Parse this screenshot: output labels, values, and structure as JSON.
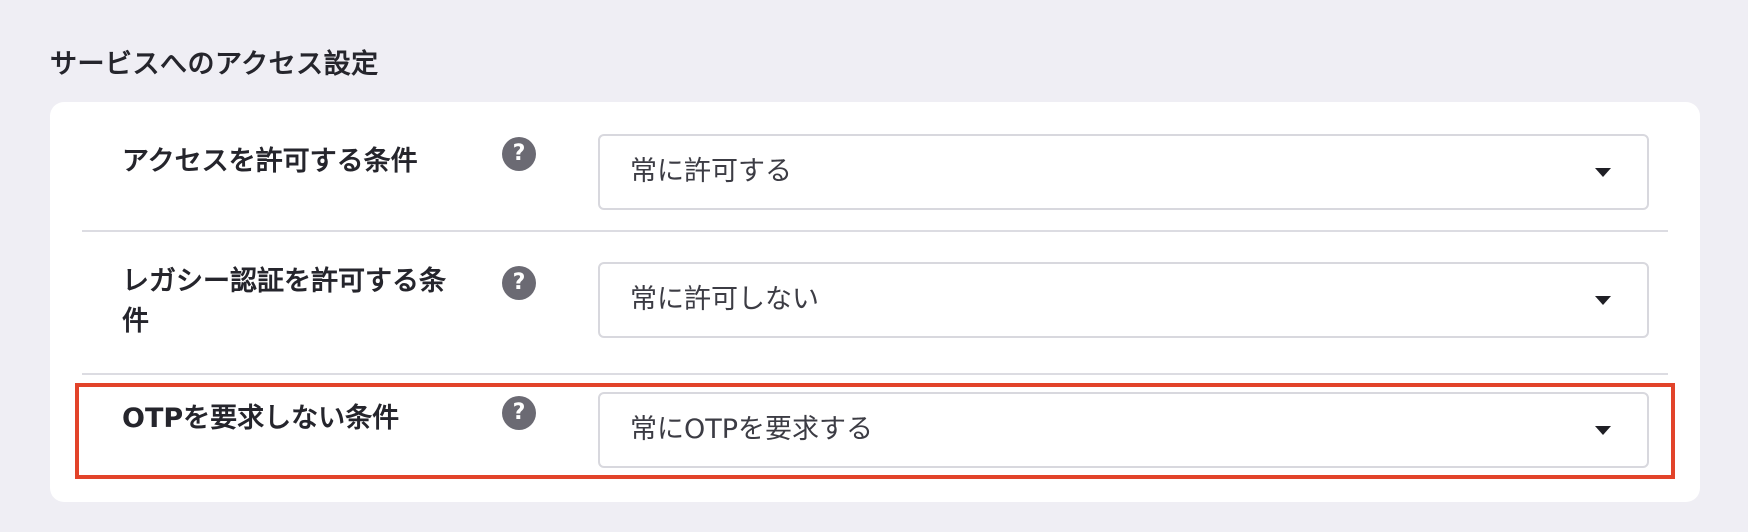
{
  "section": {
    "title": "サービスへのアクセス設定"
  },
  "settings": [
    {
      "label": "アクセスを許可する条件",
      "help_icon": "question-circle-icon",
      "selected_value": "常に許可する"
    },
    {
      "label": "レガシー認証を許可する条件",
      "help_icon": "question-circle-icon",
      "selected_value": "常に許可しない"
    },
    {
      "label": "OTPを要求しない条件",
      "help_icon": "question-circle-icon",
      "selected_value": "常にOTPを要求する",
      "highlighted": true
    }
  ],
  "colors": {
    "background": "#efeef4",
    "card": "#ffffff",
    "highlight_border": "#e2432a",
    "help_icon": "#6b6a73"
  }
}
